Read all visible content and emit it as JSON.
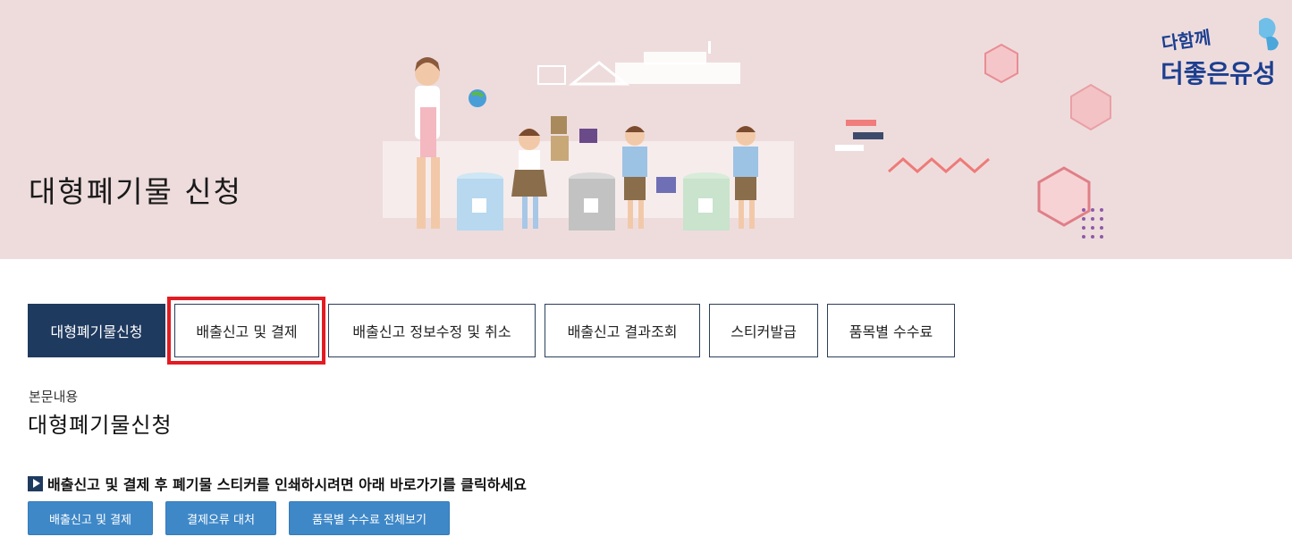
{
  "banner": {
    "title": "대형폐기물 신청",
    "logo_text": "다함께 더좋은 유성"
  },
  "tabs": [
    {
      "label": "대형폐기물신청",
      "active": true
    },
    {
      "label": "배출신고 및 결제",
      "active": false,
      "highlighted": true
    },
    {
      "label": "배출신고 정보수정 및 취소",
      "active": false
    },
    {
      "label": "배출신고 결과조회",
      "active": false
    },
    {
      "label": "스티커발급",
      "active": false
    },
    {
      "label": "품목별 수수료",
      "active": false
    }
  ],
  "content": {
    "breadcrumb": "본문내용",
    "title": "대형폐기물신청",
    "notice": "배출신고 및 결제 후 폐기물 스티커를 인쇄하시려면 아래 바로가기를 클릭하세요"
  },
  "buttons": [
    {
      "label": "배출신고 및 결제"
    },
    {
      "label": "결제오류 대처"
    },
    {
      "label": "품목별 수수료 전체보기"
    }
  ],
  "colors": {
    "banner_bg": "#eedcdd",
    "tab_active": "#1f3a5f",
    "highlight": "#e31b23",
    "button_bg": "#3f88c8"
  }
}
